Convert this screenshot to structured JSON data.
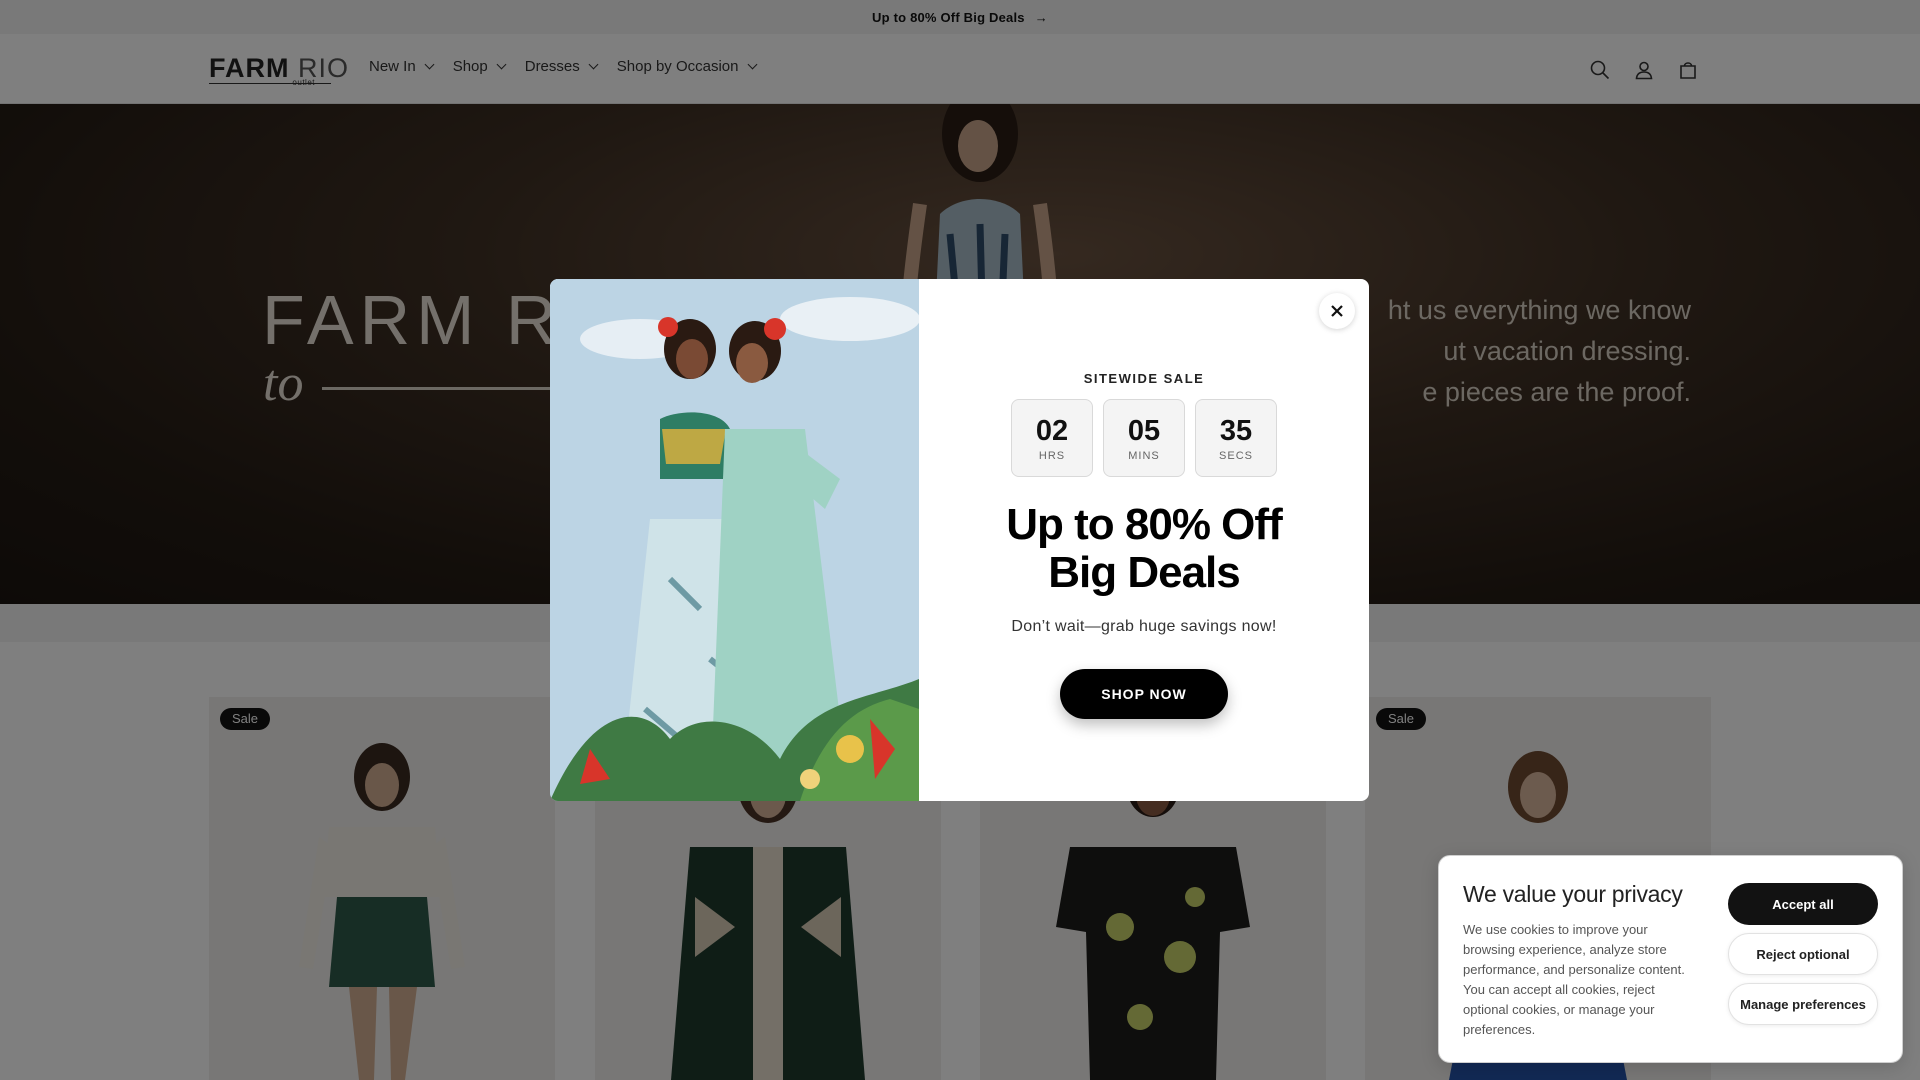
{
  "announcement": {
    "text": "Up to 80% Off Big Deals",
    "arrow": "→"
  },
  "brand": {
    "name_main": "FARM",
    "name_sub": "RIO",
    "tagline": "outlet"
  },
  "nav": {
    "items": [
      {
        "label": "New In"
      },
      {
        "label": "Shop"
      },
      {
        "label": "Dresses"
      },
      {
        "label": "Shop by Occasion"
      }
    ]
  },
  "header_icons": [
    "search-icon",
    "account-icon",
    "cart-icon"
  ],
  "hero": {
    "title": "FARM R",
    "to": "to",
    "copy_lines": [
      "ht us everything we know",
      "ut vacation dressing.",
      "e pieces are the proof."
    ]
  },
  "products": [
    {
      "badge": "Sale"
    },
    {
      "badge": ""
    },
    {
      "badge": ""
    },
    {
      "badge": "Sale"
    }
  ],
  "popup": {
    "eyebrow": "SITEWIDE SALE",
    "timer": [
      {
        "value": "02",
        "unit": "HRS"
      },
      {
        "value": "05",
        "unit": "MINS"
      },
      {
        "value": "35",
        "unit": "SECS"
      }
    ],
    "headline_line1": "Up to 80% Off",
    "headline_line2": "Big Deals",
    "subline": "Don’t wait—grab huge savings now!",
    "cta": "SHOP NOW",
    "close_icon": "close-icon"
  },
  "cookie": {
    "title": "We value your privacy",
    "text": "We use cookies to improve your browsing experience, analyze store performance, and personalize content. You can accept all cookies, reject optional cookies, or manage your preferences.",
    "accept": "Accept all",
    "reject": "Reject optional",
    "manage": "Manage preferences"
  },
  "colors": {
    "accent": "#121212",
    "hero_text": "#e8e1d6",
    "overlay": "rgba(0,0,0,0.5)"
  }
}
